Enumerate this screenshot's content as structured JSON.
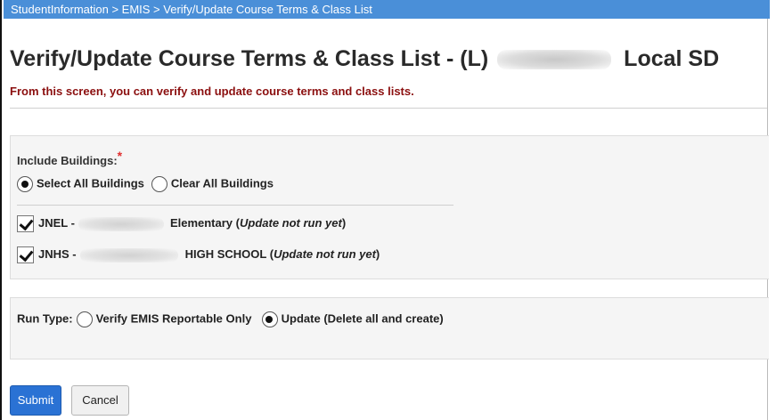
{
  "breadcrumb": "StudentInformation > EMIS > Verify/Update Course Terms & Class List",
  "title": {
    "prefix": "Verify/Update Course Terms & Class List - (L)",
    "suffix": "Local SD"
  },
  "subtitle": "From this screen, you can verify and update course terms and class lists.",
  "buildings": {
    "label": "Include Buildings:",
    "required_mark": "*",
    "select_all": {
      "label": "Select All Buildings",
      "selected": true
    },
    "clear_all": {
      "label": "Clear All Buildings",
      "selected": false
    },
    "items": [
      {
        "code": "JNEL -",
        "name": "Elementary",
        "status": "Update not run yet",
        "checked": true
      },
      {
        "code": "JNHS -",
        "name": "HIGH SCHOOL",
        "status": "Update not run yet",
        "checked": true
      }
    ]
  },
  "run_type": {
    "label": "Run Type:",
    "options": [
      {
        "label": "Verify EMIS Reportable Only",
        "selected": false
      },
      {
        "label": "Update (Delete all and create)",
        "selected": true
      }
    ]
  },
  "actions": {
    "submit": "Submit",
    "cancel": "Cancel"
  },
  "colors": {
    "header_bar": "#4a8fd8",
    "subtitle": "#8b0f0f",
    "submit": "#2a72d4",
    "required": "#e03030"
  }
}
